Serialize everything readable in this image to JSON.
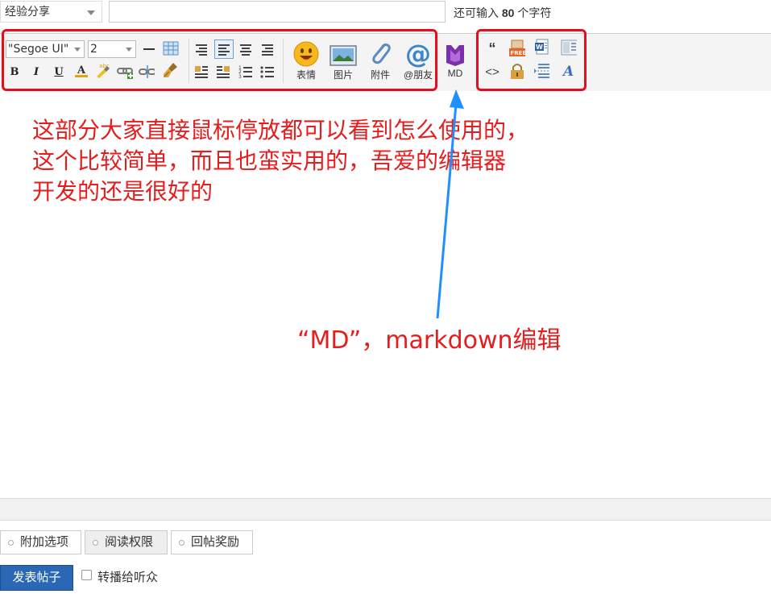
{
  "top": {
    "category": "经验分享",
    "title_value": "",
    "char_prefix": "还可输入",
    "char_count": "80",
    "char_suffix": "个字符"
  },
  "toolbar": {
    "font_family": "\"Segoe UI\"",
    "font_size": "2",
    "emoji_label": "表情",
    "image_label": "图片",
    "attach_label": "附件",
    "at_label": "@朋友",
    "md_label": "MD",
    "at_symbol": "@",
    "quote_symbol": "“",
    "code_symbol": "<>",
    "free_text": "FREE"
  },
  "annotations": {
    "main_line1": "这部分大家直接鼠标停放都可以看到怎么使用的，",
    "main_line2": "这个比较简单，而且也蛮实用的，吾爱的编辑器",
    "main_line3": "开发的还是很好的",
    "md_note": "“MD”，markdown编辑"
  },
  "tabs": [
    {
      "label": "附加选项"
    },
    {
      "label": "阅读权限"
    },
    {
      "label": "回帖奖励"
    }
  ],
  "footer": {
    "submit_label": "发表帖子",
    "forward_label": "转播给听众"
  },
  "colors": {
    "annotation_red": "#e41e1e",
    "arrow_blue": "#1e90ff",
    "submit_blue": "#2a68b6"
  }
}
